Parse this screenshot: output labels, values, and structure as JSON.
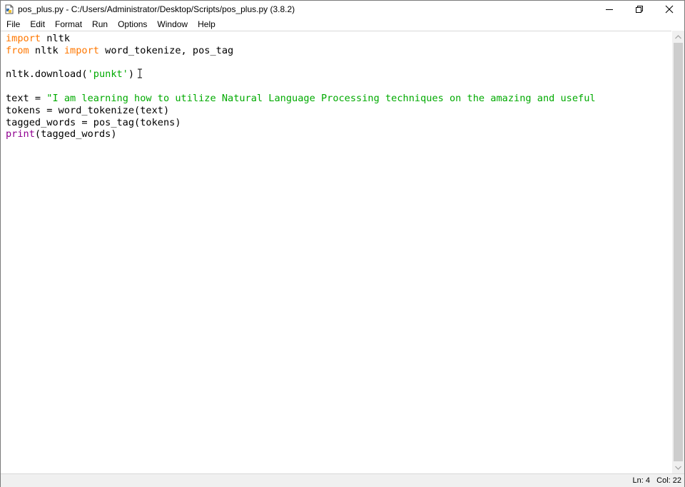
{
  "window": {
    "title": "pos_plus.py - C:/Users/Administrator/Desktop/Scripts/pos_plus.py (3.8.2)",
    "icon": "python-file-icon",
    "controls": [
      "minimize-icon",
      "restore-icon",
      "close-icon"
    ]
  },
  "menu": {
    "items": [
      "File",
      "Edit",
      "Format",
      "Run",
      "Options",
      "Window",
      "Help"
    ]
  },
  "editor": {
    "lines": [
      [
        {
          "t": "import",
          "c": "kw"
        },
        {
          "t": " nltk",
          "c": ""
        }
      ],
      [
        {
          "t": "from",
          "c": "kw"
        },
        {
          "t": " nltk ",
          "c": ""
        },
        {
          "t": "import",
          "c": "kw"
        },
        {
          "t": " word_tokenize, pos_tag",
          "c": ""
        }
      ],
      [],
      [
        {
          "t": "nltk.download(",
          "c": ""
        },
        {
          "t": "'punkt'",
          "c": "str"
        },
        {
          "t": ")",
          "c": ""
        }
      ],
      [],
      [
        {
          "t": "text = ",
          "c": ""
        },
        {
          "t": "\"I am learning how to utilize Natural Language Processing techniques on the amazing and useful",
          "c": "str"
        }
      ],
      [
        {
          "t": "tokens = word_tokenize(text)",
          "c": ""
        }
      ],
      [
        {
          "t": "tagged_words = pos_tag(tokens)",
          "c": ""
        }
      ],
      [
        {
          "t": "print",
          "c": "bi"
        },
        {
          "t": "(tagged_words)",
          "c": ""
        }
      ]
    ],
    "colors": {
      "keyword": "#ff7700",
      "string": "#00aa00",
      "builtin": "#900090"
    }
  },
  "status": {
    "line": "Ln: 4",
    "col": "Col: 22"
  }
}
